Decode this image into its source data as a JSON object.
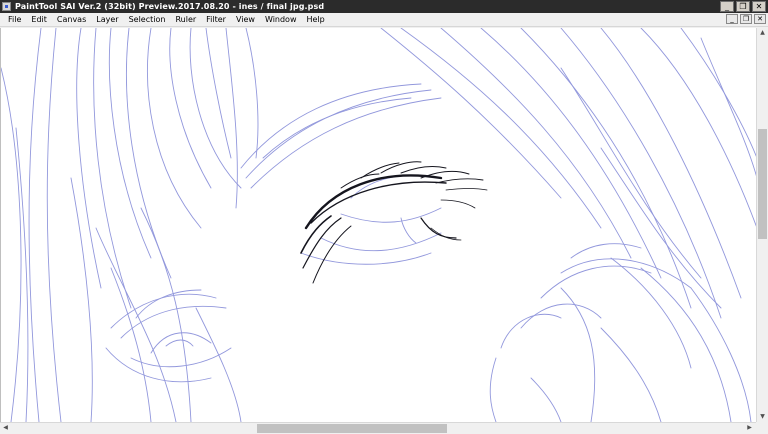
{
  "window": {
    "title": "PaintTool SAI Ver.2 (32bit) Preview.2017.08.20 - ines / final jpg.psd",
    "minimize": "_",
    "restore": "❐",
    "close": "✕"
  },
  "menu": {
    "items": [
      "File",
      "Edit",
      "Canvas",
      "Layer",
      "Selection",
      "Ruler",
      "Filter",
      "View",
      "Window",
      "Help"
    ]
  },
  "document_buttons": {
    "minimize": "_",
    "restore": "❐",
    "close": "✕"
  },
  "scrollbars": {
    "up": "▲",
    "down": "▼",
    "left": "◀",
    "right": "▶"
  },
  "colors": {
    "sketch": "#7f86d6",
    "ink": "#15151e",
    "titlebar": "#2b2b2b"
  }
}
